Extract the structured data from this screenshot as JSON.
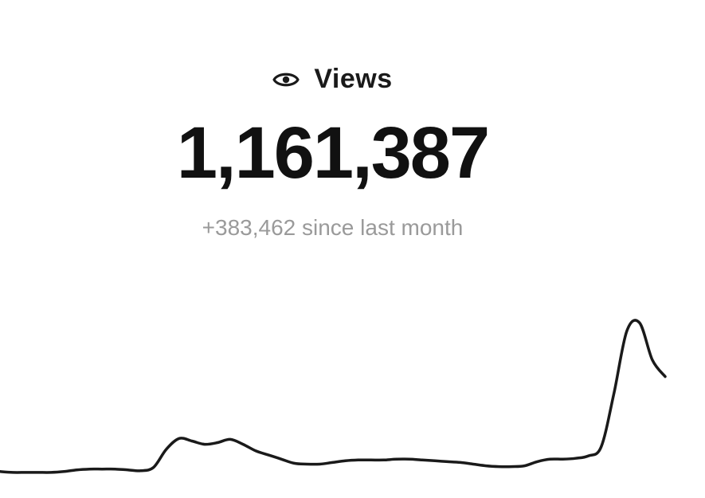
{
  "card": {
    "icon": "eye-icon",
    "label": "Views",
    "value": "1,161,387",
    "delta": "+383,462 since last month"
  },
  "colors": {
    "text_primary": "#111111",
    "text_secondary": "#9a9a9a",
    "line": "#1a1a1a",
    "background": "#ffffff"
  },
  "chart_data": {
    "type": "line",
    "title": "",
    "xlabel": "",
    "ylabel": "",
    "grid": false,
    "legend": "none",
    "ylim": [
      0,
      190
    ],
    "series": [
      {
        "values": [
          5,
          4,
          4,
          4,
          4,
          5,
          7,
          8,
          8,
          8,
          7,
          6,
          10,
          32,
          45,
          42,
          38,
          40,
          44,
          38,
          30,
          25,
          20,
          15,
          14,
          14,
          16,
          18,
          19,
          19,
          19,
          20,
          20,
          19,
          18,
          17,
          16,
          14,
          12,
          11,
          11,
          12,
          17,
          20,
          20,
          21,
          24,
          35,
          100,
          175,
          185,
          140,
          120
        ]
      }
    ]
  }
}
